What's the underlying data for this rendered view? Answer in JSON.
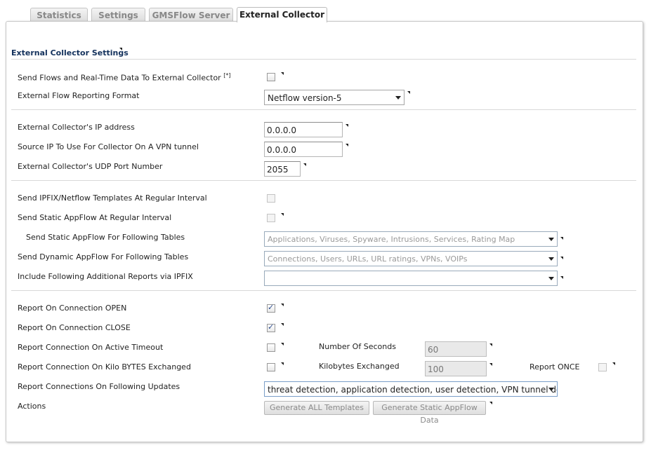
{
  "tabs": [
    {
      "label": "Statistics"
    },
    {
      "label": "Settings"
    },
    {
      "label": "GMSFlow Server"
    },
    {
      "label": "External Collector"
    }
  ],
  "section_title": "External Collector Settings",
  "rows": {
    "send_flows": {
      "label": "Send Flows and Real-Time Data To External Collector",
      "note": "[*]",
      "checked": false
    },
    "reporting_format": {
      "label": "External Flow Reporting Format",
      "value": "Netflow version-5"
    },
    "collector_ip": {
      "label": "External Collector's IP address",
      "value": "0.0.0.0"
    },
    "source_ip": {
      "label": "Source IP To Use For Collector On A VPN tunnel",
      "value": "0.0.0.0"
    },
    "udp_port": {
      "label": "External Collector's UDP Port Number",
      "value": "2055"
    },
    "send_templates": {
      "label": "Send IPFIX/Netflow Templates At Regular Interval",
      "checked": false
    },
    "send_static_appflow": {
      "label": "Send Static AppFlow At Regular Interval",
      "checked": false
    },
    "static_tables": {
      "label": "Send Static AppFlow For Following Tables",
      "placeholder": "Applications, Viruses, Spyware, Intrusions, Services, Rating Map"
    },
    "dynamic_tables": {
      "label": "Send Dynamic AppFlow For Following Tables",
      "placeholder": "Connections, Users, URLs, URL ratings, VPNs, VOIPs"
    },
    "additional_reports": {
      "label": "Include Following Additional Reports via IPFIX",
      "value": ""
    },
    "report_open": {
      "label": "Report On Connection OPEN",
      "checked": true
    },
    "report_close": {
      "label": "Report On Connection CLOSE",
      "checked": true
    },
    "active_timeout": {
      "label": "Report Connection On Active Timeout",
      "checked": false,
      "sub_label": "Number Of Seconds",
      "sub_value": "60"
    },
    "kilo_bytes": {
      "label": "Report Connection On Kilo BYTES Exchanged",
      "checked": false,
      "sub_label": "Kilobytes Exchanged",
      "sub_value": "100",
      "once_label": "Report ONCE",
      "once_checked": false
    },
    "following_updates": {
      "label": "Report Connections On Following Updates",
      "value": "threat detection, application detection, user detection, VPN tunnel detection, URL"
    },
    "actions": {
      "label": "Actions",
      "generate_templates": "Generate ALL Templates",
      "generate_static": "Generate Static AppFlow Data"
    }
  }
}
